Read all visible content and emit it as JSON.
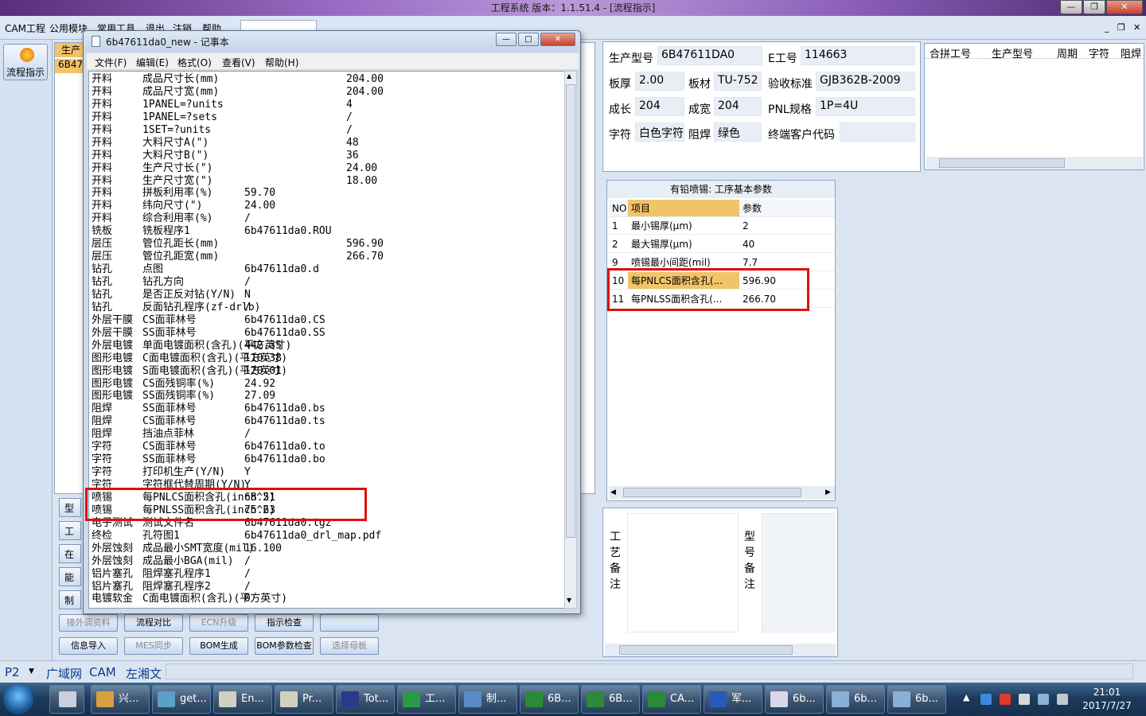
{
  "app": {
    "title": "工程系统   版本：1.1.51.4 - [流程指示]",
    "menu": [
      "CAM工程",
      "公用模块",
      "常用工具",
      "退出",
      "注销",
      "帮助"
    ],
    "window_controls": [
      "—",
      "❐",
      "✕"
    ],
    "mdi_controls": [
      "_",
      "❐",
      "✕"
    ]
  },
  "left_rail": {
    "flow_button": "流程指示"
  },
  "tree": {
    "header": "生产",
    "row": "6B47"
  },
  "side_tabs": [
    "型号",
    "工具",
    "在线",
    "能力",
    "制作"
  ],
  "buttons": {
    "row1": [
      "接外调资料",
      "流程对比",
      "ECN升级",
      "指示检查",
      ""
    ],
    "row2": [
      "信息导入",
      "MES同步",
      "BOM生成",
      "BOM参数检查",
      "选择母板"
    ]
  },
  "notepad": {
    "title": "6b47611da0_new - 记事本",
    "controls": [
      "—",
      "□",
      "✕"
    ],
    "menu": [
      "文件(F)",
      "编辑(E)",
      "格式(O)",
      "查看(V)",
      "帮助(H)"
    ],
    "lines": [
      [
        "开料",
        "成品尺寸长(mm)",
        "",
        "204.00"
      ],
      [
        "开料",
        "成品尺寸宽(mm)",
        "",
        "204.00"
      ],
      [
        "开料",
        "1PANEL=?units",
        "",
        "4"
      ],
      [
        "开料",
        "1PANEL=?sets",
        "",
        "/"
      ],
      [
        "开料",
        "1SET=?units",
        "",
        "/"
      ],
      [
        "开料",
        "大料尺寸A(\")",
        "",
        "48"
      ],
      [
        "开料",
        "大料尺寸B(\")",
        "",
        "36"
      ],
      [
        "开料",
        "生产尺寸长(\")",
        "",
        "24.00"
      ],
      [
        "开料",
        "生产尺寸宽(\")",
        "",
        "18.00"
      ],
      [
        "开料",
        "拼板利用率(%)",
        "59.70",
        ""
      ],
      [
        "开料",
        "纬向尺寸(\")",
        "24.00",
        ""
      ],
      [
        "开料",
        "综合利用率(%)",
        "/",
        ""
      ],
      [
        "铣板",
        "铣板程序1",
        "6b47611da0.ROU",
        ""
      ],
      [
        "层压",
        "管位孔距长(mm)",
        "",
        "596.90"
      ],
      [
        "层压",
        "管位孔距宽(mm)",
        "",
        "266.70"
      ],
      [
        "钻孔",
        "点图",
        "6b47611da0.d",
        ""
      ],
      [
        "钻孔",
        "钻孔方向",
        "/",
        ""
      ],
      [
        "钻孔",
        "是否正反对钻(Y/N)",
        "N",
        ""
      ],
      [
        "钻孔",
        "反面钻孔程序(zf-drlb)",
        "/",
        ""
      ],
      [
        "外层干膜",
        "CS面菲林号",
        "6b47611da0.CS",
        ""
      ],
      [
        "外层干膜",
        "SS面菲林号",
        "6b47611da0.SS",
        ""
      ],
      [
        "外层电镀",
        "单面电镀面积(含孔)(平方英寸)",
        "442.35",
        ""
      ],
      [
        "图形电镀",
        "C面电镀面积(含孔)(平方英寸)",
        "110.38",
        ""
      ],
      [
        "图形电镀",
        "S面电镀面积(含孔)(平方英寸)",
        "120.01",
        ""
      ],
      [
        "图形电镀",
        "CS面残铜率(%)",
        "24.92",
        ""
      ],
      [
        "图形电镀",
        "SS面残铜率(%)",
        "27.09",
        ""
      ],
      [
        "阻焊",
        "SS面菲林号",
        "6b47611da0.bs",
        ""
      ],
      [
        "阻焊",
        "CS面菲林号",
        "6b47611da0.ts",
        ""
      ],
      [
        "阻焊",
        "挡油点菲林",
        "/",
        ""
      ],
      [
        "字符",
        "CS面菲林号",
        "6b47611da0.to",
        ""
      ],
      [
        "字符",
        "SS面菲林号",
        "6b47611da0.bo",
        ""
      ],
      [
        "字符",
        "打印机生产(Y/N)",
        "Y",
        ""
      ],
      [
        "字符",
        "字符框代替周期(Y/N)",
        "Y",
        ""
      ],
      [
        "喷锡",
        "每PNLCS面积含孔(inch^2)",
        "68.51",
        ""
      ],
      [
        "喷锡",
        "每PNLSS面积含孔(inch^2)",
        "75.63",
        ""
      ],
      [
        "电子测试",
        "测试文件名",
        "6b47611da0.tgz",
        ""
      ],
      [
        "终检",
        "孔符图1",
        "6b47611da0_drl_map.pdf",
        ""
      ],
      [
        "外层蚀刻",
        "成品最小SMT宽度(mil)",
        "16.100",
        ""
      ],
      [
        "外层蚀刻",
        "成品最小BGA(mil)",
        "/",
        ""
      ],
      [
        "铝片塞孔",
        "阻焊塞孔程序1",
        "/",
        ""
      ],
      [
        "铝片塞孔",
        "阻焊塞孔程序2",
        "/",
        ""
      ],
      [
        "电镀软金",
        "C面电镀面积(含孔)(平方英寸)",
        "0",
        ""
      ]
    ]
  },
  "info": {
    "prod_model_label": "生产型号",
    "prod_model": "6B47611DA0",
    "e_no_label": "E工号",
    "e_no": "114663",
    "thickness_label": "板厚",
    "thickness": "2.00",
    "material_label": "板材",
    "material": "TU-752",
    "standard_label": "验收标准",
    "standard": "GJB362B-2009",
    "length_label": "成长",
    "length": "204",
    "width_label": "成宽",
    "width": "204",
    "pnl_label": "PNL规格",
    "pnl": "1P=4U",
    "char_label": "字符",
    "char": "白色字符",
    "mask_label": "阻焊",
    "mask": "绿色",
    "customer_label": "终端客户代码",
    "customer": ""
  },
  "grid_top": {
    "headers": [
      "合拼工号",
      "生产型号",
      "周期",
      "字符",
      "阻焊"
    ]
  },
  "params": {
    "title": "有铅喷锡: 工序基本参数",
    "headers": [
      "NO",
      "项目",
      "参数"
    ],
    "rows": [
      [
        "1",
        "最小锡厚(μm)",
        "2"
      ],
      [
        "2",
        "最大锡厚(μm)",
        "40"
      ],
      [
        "9",
        "喷锡最小间距(mil)",
        "7.7"
      ],
      [
        "10",
        "每PNLCS面积含孔(...",
        "596.90"
      ],
      [
        "11",
        "每PNLSS面积含孔(...",
        "266.70"
      ]
    ]
  },
  "remarks": {
    "process": "工艺备注",
    "model": "型号备注"
  },
  "status": {
    "page": "P2",
    "items": [
      "广域网",
      "CAM",
      "左湘文"
    ]
  },
  "taskbar": {
    "items": [
      "兴...",
      "get...",
      "En...",
      "Pr...",
      "Tot...",
      "工...",
      "制...",
      "6B...",
      "6B...",
      "CA...",
      "军...",
      "6b...",
      "6b...",
      "6b..."
    ],
    "time": "21:01",
    "date": "2017/7/27"
  },
  "colors": {
    "accent": "#f2c46a",
    "highlight": "#e01010",
    "taskbar": "#1e3a5c"
  }
}
